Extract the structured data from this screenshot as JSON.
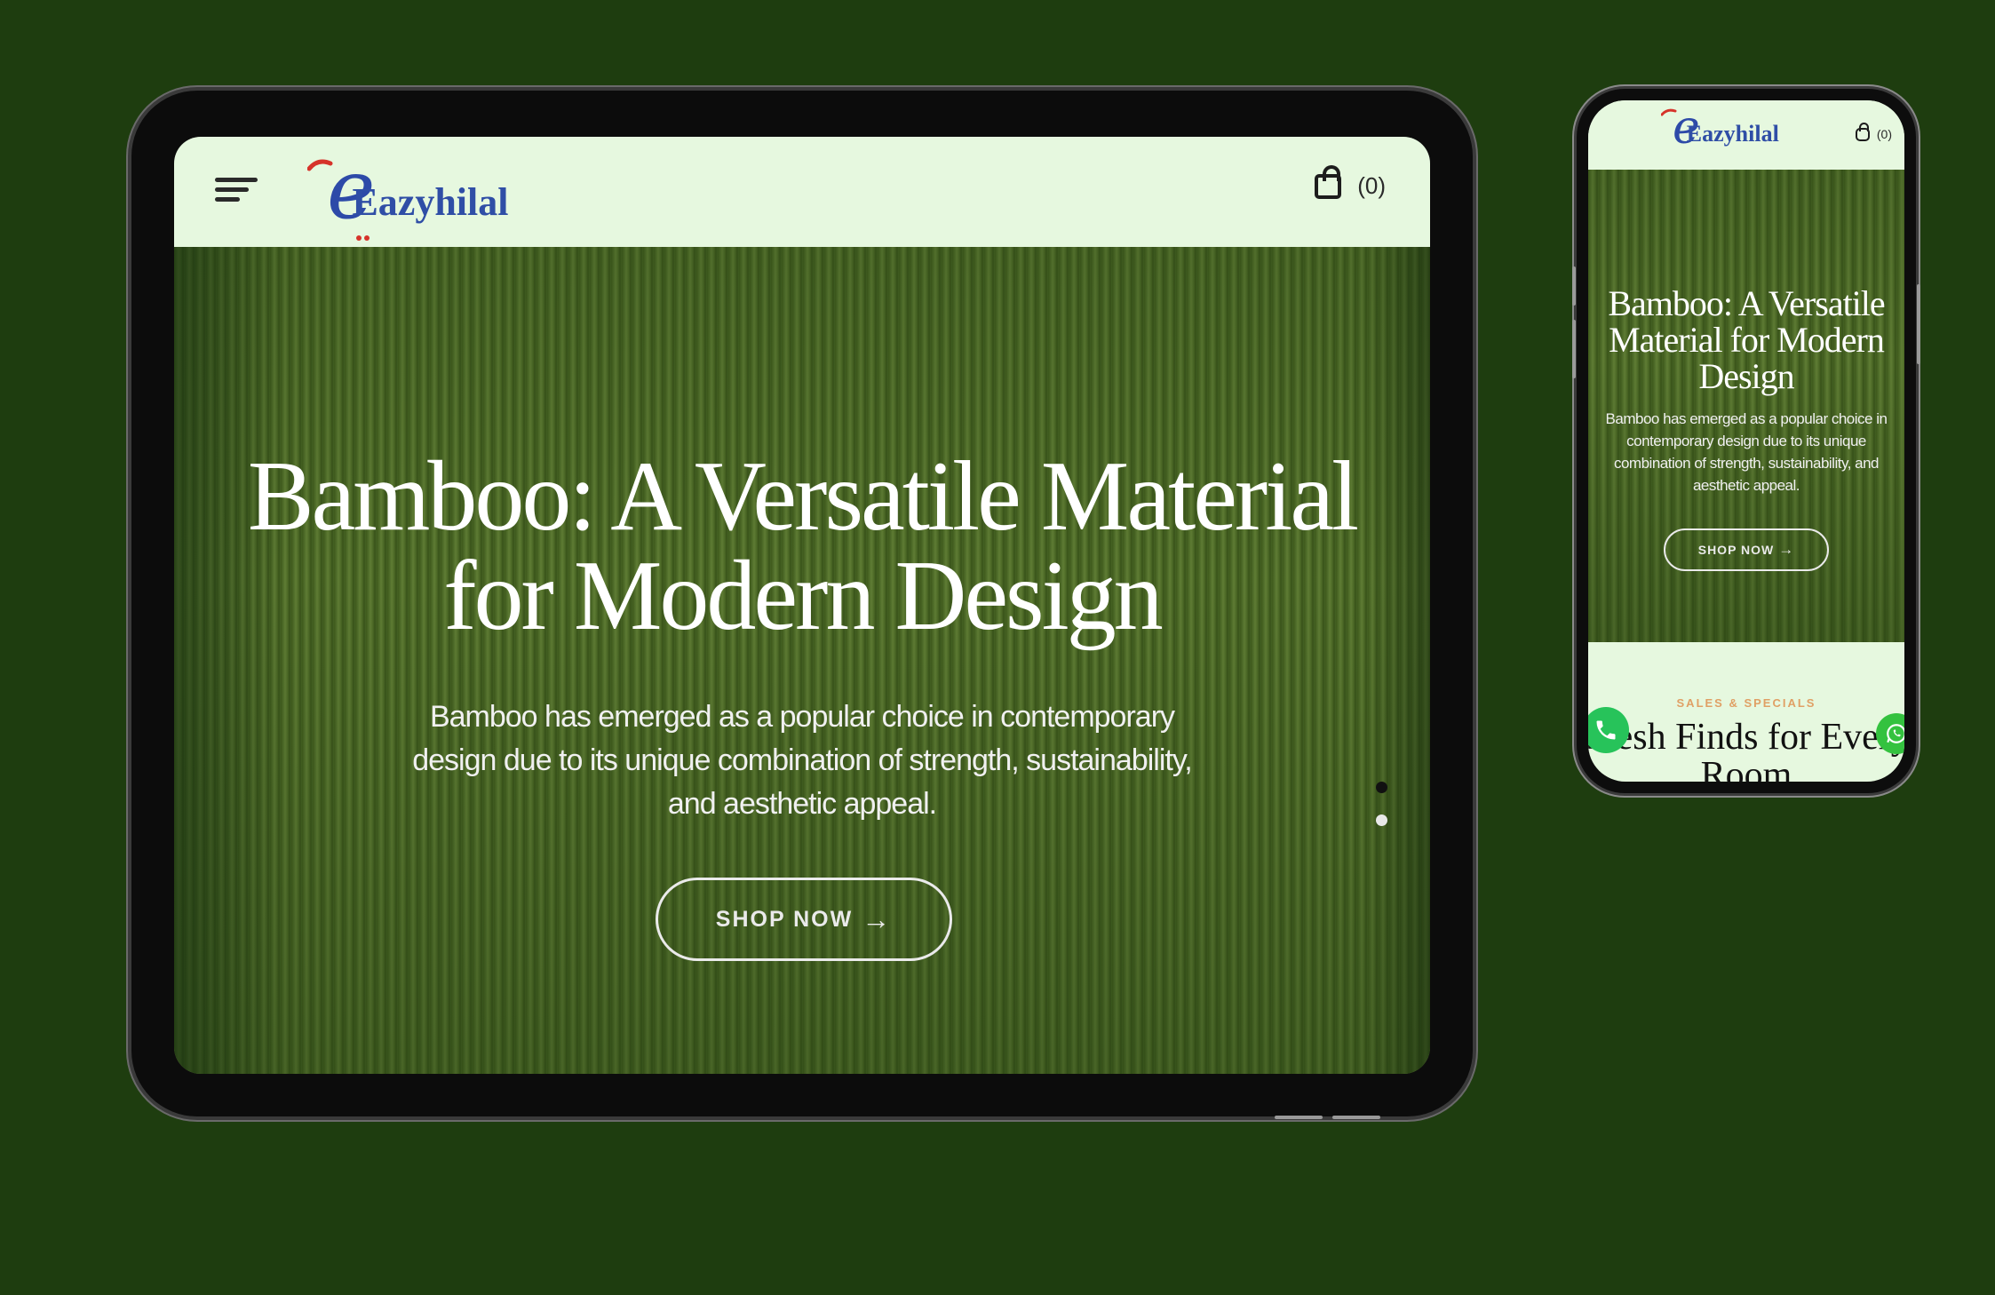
{
  "brand": {
    "logo_e": "e",
    "logo_name": "Eazyhilal"
  },
  "cart": {
    "count": "(0)"
  },
  "hero": {
    "title": "Bamboo: A Versatile Material for Modern Design",
    "subtitle": "Bamboo has emerged as a popular choice in contemporary design due to its unique combination of strength, sustainability, and aesthetic appeal.",
    "button_label": "SHOP NOW",
    "button_arrow": "→"
  },
  "mobile": {
    "sales_label": "SALES & SPECIALS",
    "section_title_line1": "Fresh Finds for Every",
    "section_title_line2": "Room"
  },
  "icons": {
    "menu": "hamburger-icon",
    "cart": "shopping-bag-icon",
    "phone": "phone-icon",
    "whatsapp": "whatsapp-icon"
  },
  "colors": {
    "background": "#1e3d0f",
    "header": "#e6f8df",
    "logo_blue": "#2f4ea6",
    "logo_red": "#d6332a",
    "sales_accent": "#e0a065",
    "whatsapp_green": "#34c23f"
  }
}
